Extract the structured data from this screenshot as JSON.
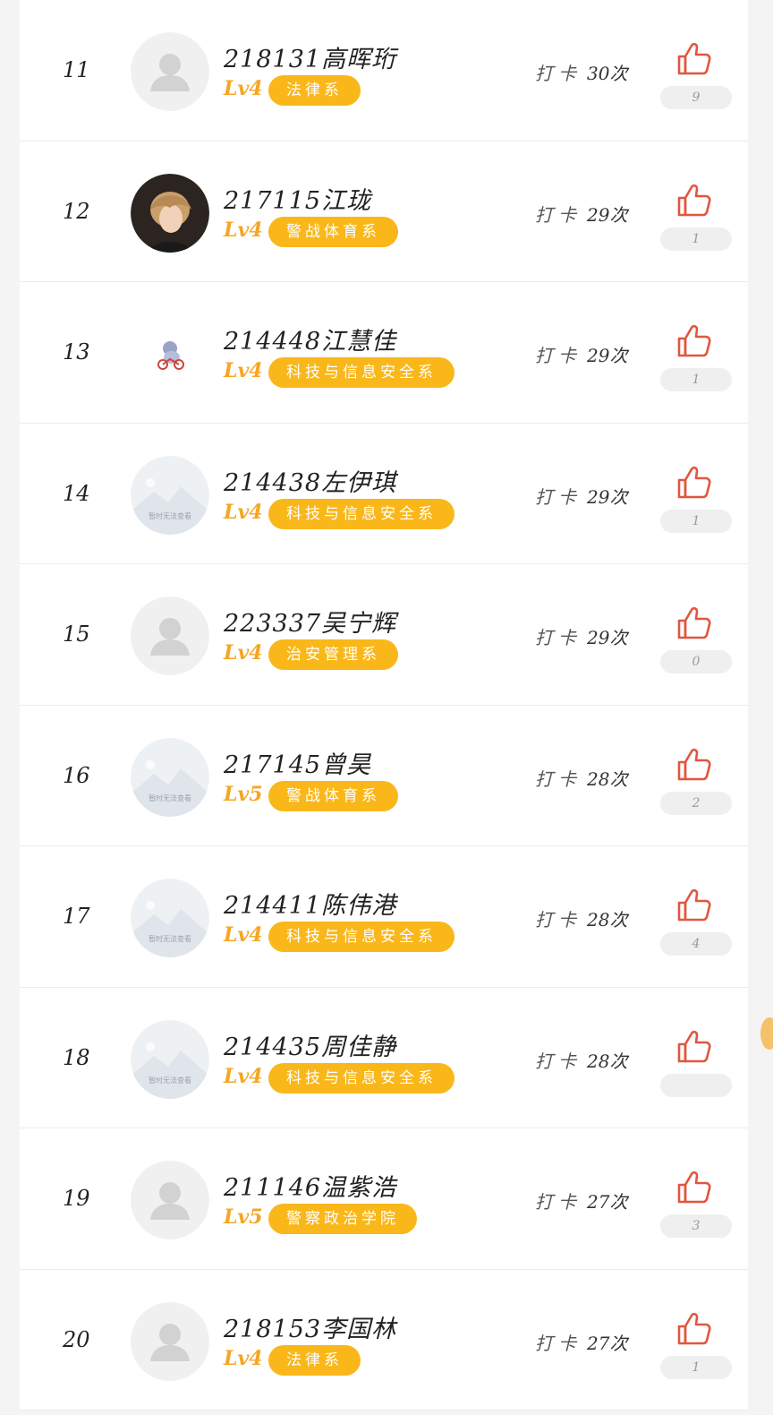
{
  "checkin_label": "打卡",
  "rows": [
    {
      "rank": "11",
      "name": "218131高晖珩",
      "level": "Lv4",
      "dept": "法律系",
      "count": "30次",
      "likes": "9",
      "avatar": "default"
    },
    {
      "rank": "12",
      "name": "217115江珑",
      "level": "Lv4",
      "dept": "警战体育系",
      "count": "29次",
      "likes": "1",
      "avatar": "photo"
    },
    {
      "rank": "13",
      "name": "214448江慧佳",
      "level": "Lv4",
      "dept": "科技与信息安全系",
      "count": "29次",
      "likes": "1",
      "avatar": "cartoon"
    },
    {
      "rank": "14",
      "name": "214438左伊琪",
      "level": "Lv4",
      "dept": "科技与信息安全系",
      "count": "29次",
      "likes": "1",
      "avatar": "placeholder"
    },
    {
      "rank": "15",
      "name": "223337吴宁辉",
      "level": "Lv4",
      "dept": "治安管理系",
      "count": "29次",
      "likes": "0",
      "avatar": "default"
    },
    {
      "rank": "16",
      "name": "217145曾昊",
      "level": "Lv5",
      "dept": "警战体育系",
      "count": "28次",
      "likes": "2",
      "avatar": "placeholder"
    },
    {
      "rank": "17",
      "name": "214411陈伟港",
      "level": "Lv4",
      "dept": "科技与信息安全系",
      "count": "28次",
      "likes": "4",
      "avatar": "placeholder"
    },
    {
      "rank": "18",
      "name": "214435周佳静",
      "level": "Lv4",
      "dept": "科技与信息安全系",
      "count": "28次",
      "likes": "",
      "avatar": "placeholder"
    },
    {
      "rank": "19",
      "name": "211146温紫浩",
      "level": "Lv5",
      "dept": "警察政治学院",
      "count": "27次",
      "likes": "3",
      "avatar": "default"
    },
    {
      "rank": "20",
      "name": "218153李国林",
      "level": "Lv4",
      "dept": "法律系",
      "count": "27次",
      "likes": "1",
      "avatar": "default"
    }
  ],
  "placeholder_text": "暂时无法查看",
  "colors": {
    "accent": "#f9b71a",
    "level": "#f6a623",
    "like": "#e0573f"
  }
}
